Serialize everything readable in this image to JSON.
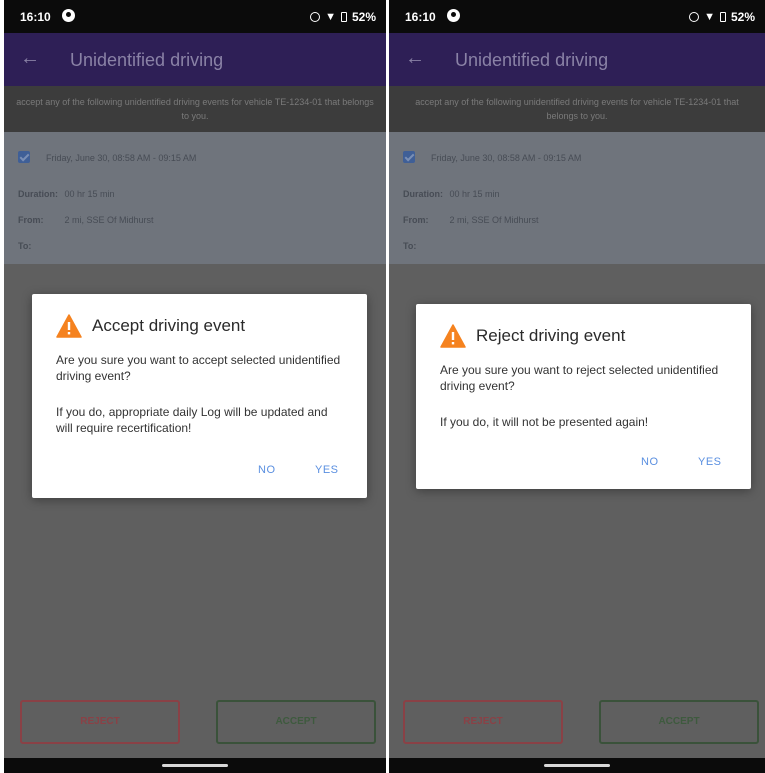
{
  "colors": {
    "app_bar": "#2e1f56",
    "scrim": "#5f5f5f",
    "dialog_action": "#5a8fe0",
    "warning": "#f5821f",
    "reject_outline": "#8a4146",
    "accept_outline": "#3a523a"
  },
  "screens": [
    {
      "status_bar": {
        "time": "16:10",
        "battery": "52%"
      },
      "app_bar": {
        "back_icon": "arrow-back-icon",
        "title": "Unidentified driving"
      },
      "instructions": "accept any of the following unidentified driving events for vehicle TE-1234-01 that belongs to you.",
      "event": {
        "datetime": "Friday, June 30, 08:58 AM - 09:15 AM",
        "duration_label": "Duration:",
        "duration_value": "00 hr 15 min",
        "from_label": "From:",
        "from_value": "2 mi, SSE Of Midhurst",
        "to_label": "To:"
      },
      "dialog": {
        "icon": "warning-icon",
        "title": "Accept driving event",
        "message": "Are you sure you want to accept selected unidentified driving event?",
        "detail": "If you do, appropriate daily Log will be updated and will require recertification!",
        "no": "NO",
        "yes": "YES"
      },
      "buttons": {
        "reject": "REJECT",
        "accept": "ACCEPT"
      }
    },
    {
      "status_bar": {
        "time": "16:10",
        "battery": "52%"
      },
      "app_bar": {
        "back_icon": "arrow-back-icon",
        "title": "Unidentified driving"
      },
      "instructions": "accept any of the following unidentified driving events for vehicle TE-1234-01 that belongs to you.",
      "event": {
        "datetime": "Friday, June 30, 08:58 AM - 09:15 AM",
        "duration_label": "Duration:",
        "duration_value": "00 hr 15 min",
        "from_label": "From:",
        "from_value": "2 mi, SSE Of Midhurst",
        "to_label": "To:"
      },
      "dialog": {
        "icon": "warning-icon",
        "title": "Reject driving event",
        "message": "Are you sure you want to reject selected unidentified driving event?",
        "detail": "If you do, it will not be presented again!",
        "no": "NO",
        "yes": "YES"
      },
      "buttons": {
        "reject": "REJECT",
        "accept": "ACCEPT"
      }
    }
  ]
}
